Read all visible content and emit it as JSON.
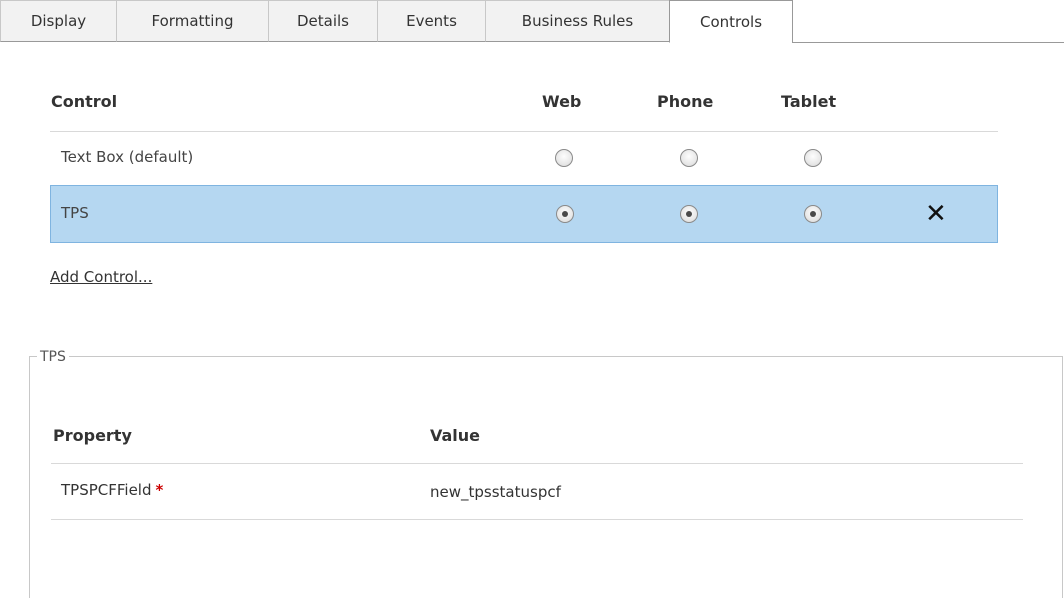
{
  "tabs": [
    {
      "label": "Display",
      "active": false
    },
    {
      "label": "Formatting",
      "active": false
    },
    {
      "label": "Details",
      "active": false
    },
    {
      "label": "Events",
      "active": false
    },
    {
      "label": "Business Rules",
      "active": false
    },
    {
      "label": "Controls",
      "active": true
    }
  ],
  "controls_table": {
    "headers": {
      "control": "Control",
      "web": "Web",
      "phone": "Phone",
      "tablet": "Tablet"
    },
    "rows": [
      {
        "label": "Text Box (default)",
        "web": false,
        "phone": false,
        "tablet": false,
        "selected": false
      },
      {
        "label": "TPS",
        "web": true,
        "phone": true,
        "tablet": true,
        "selected": true,
        "remove_icon": "close-x-icon",
        "remove_glyph": "✕"
      }
    ],
    "add_control_label": "Add Control..."
  },
  "properties": {
    "legend": "TPS",
    "headers": {
      "property": "Property",
      "value": "Value"
    },
    "rows": [
      {
        "name": "TPSPCFField",
        "required_mark": "*",
        "value": "new_tpsstatuspcf"
      }
    ]
  },
  "colors": {
    "selected_row_bg": "#b5d7f1",
    "selected_row_border": "#7fb4e0",
    "required_asterisk": "#cc0000"
  }
}
